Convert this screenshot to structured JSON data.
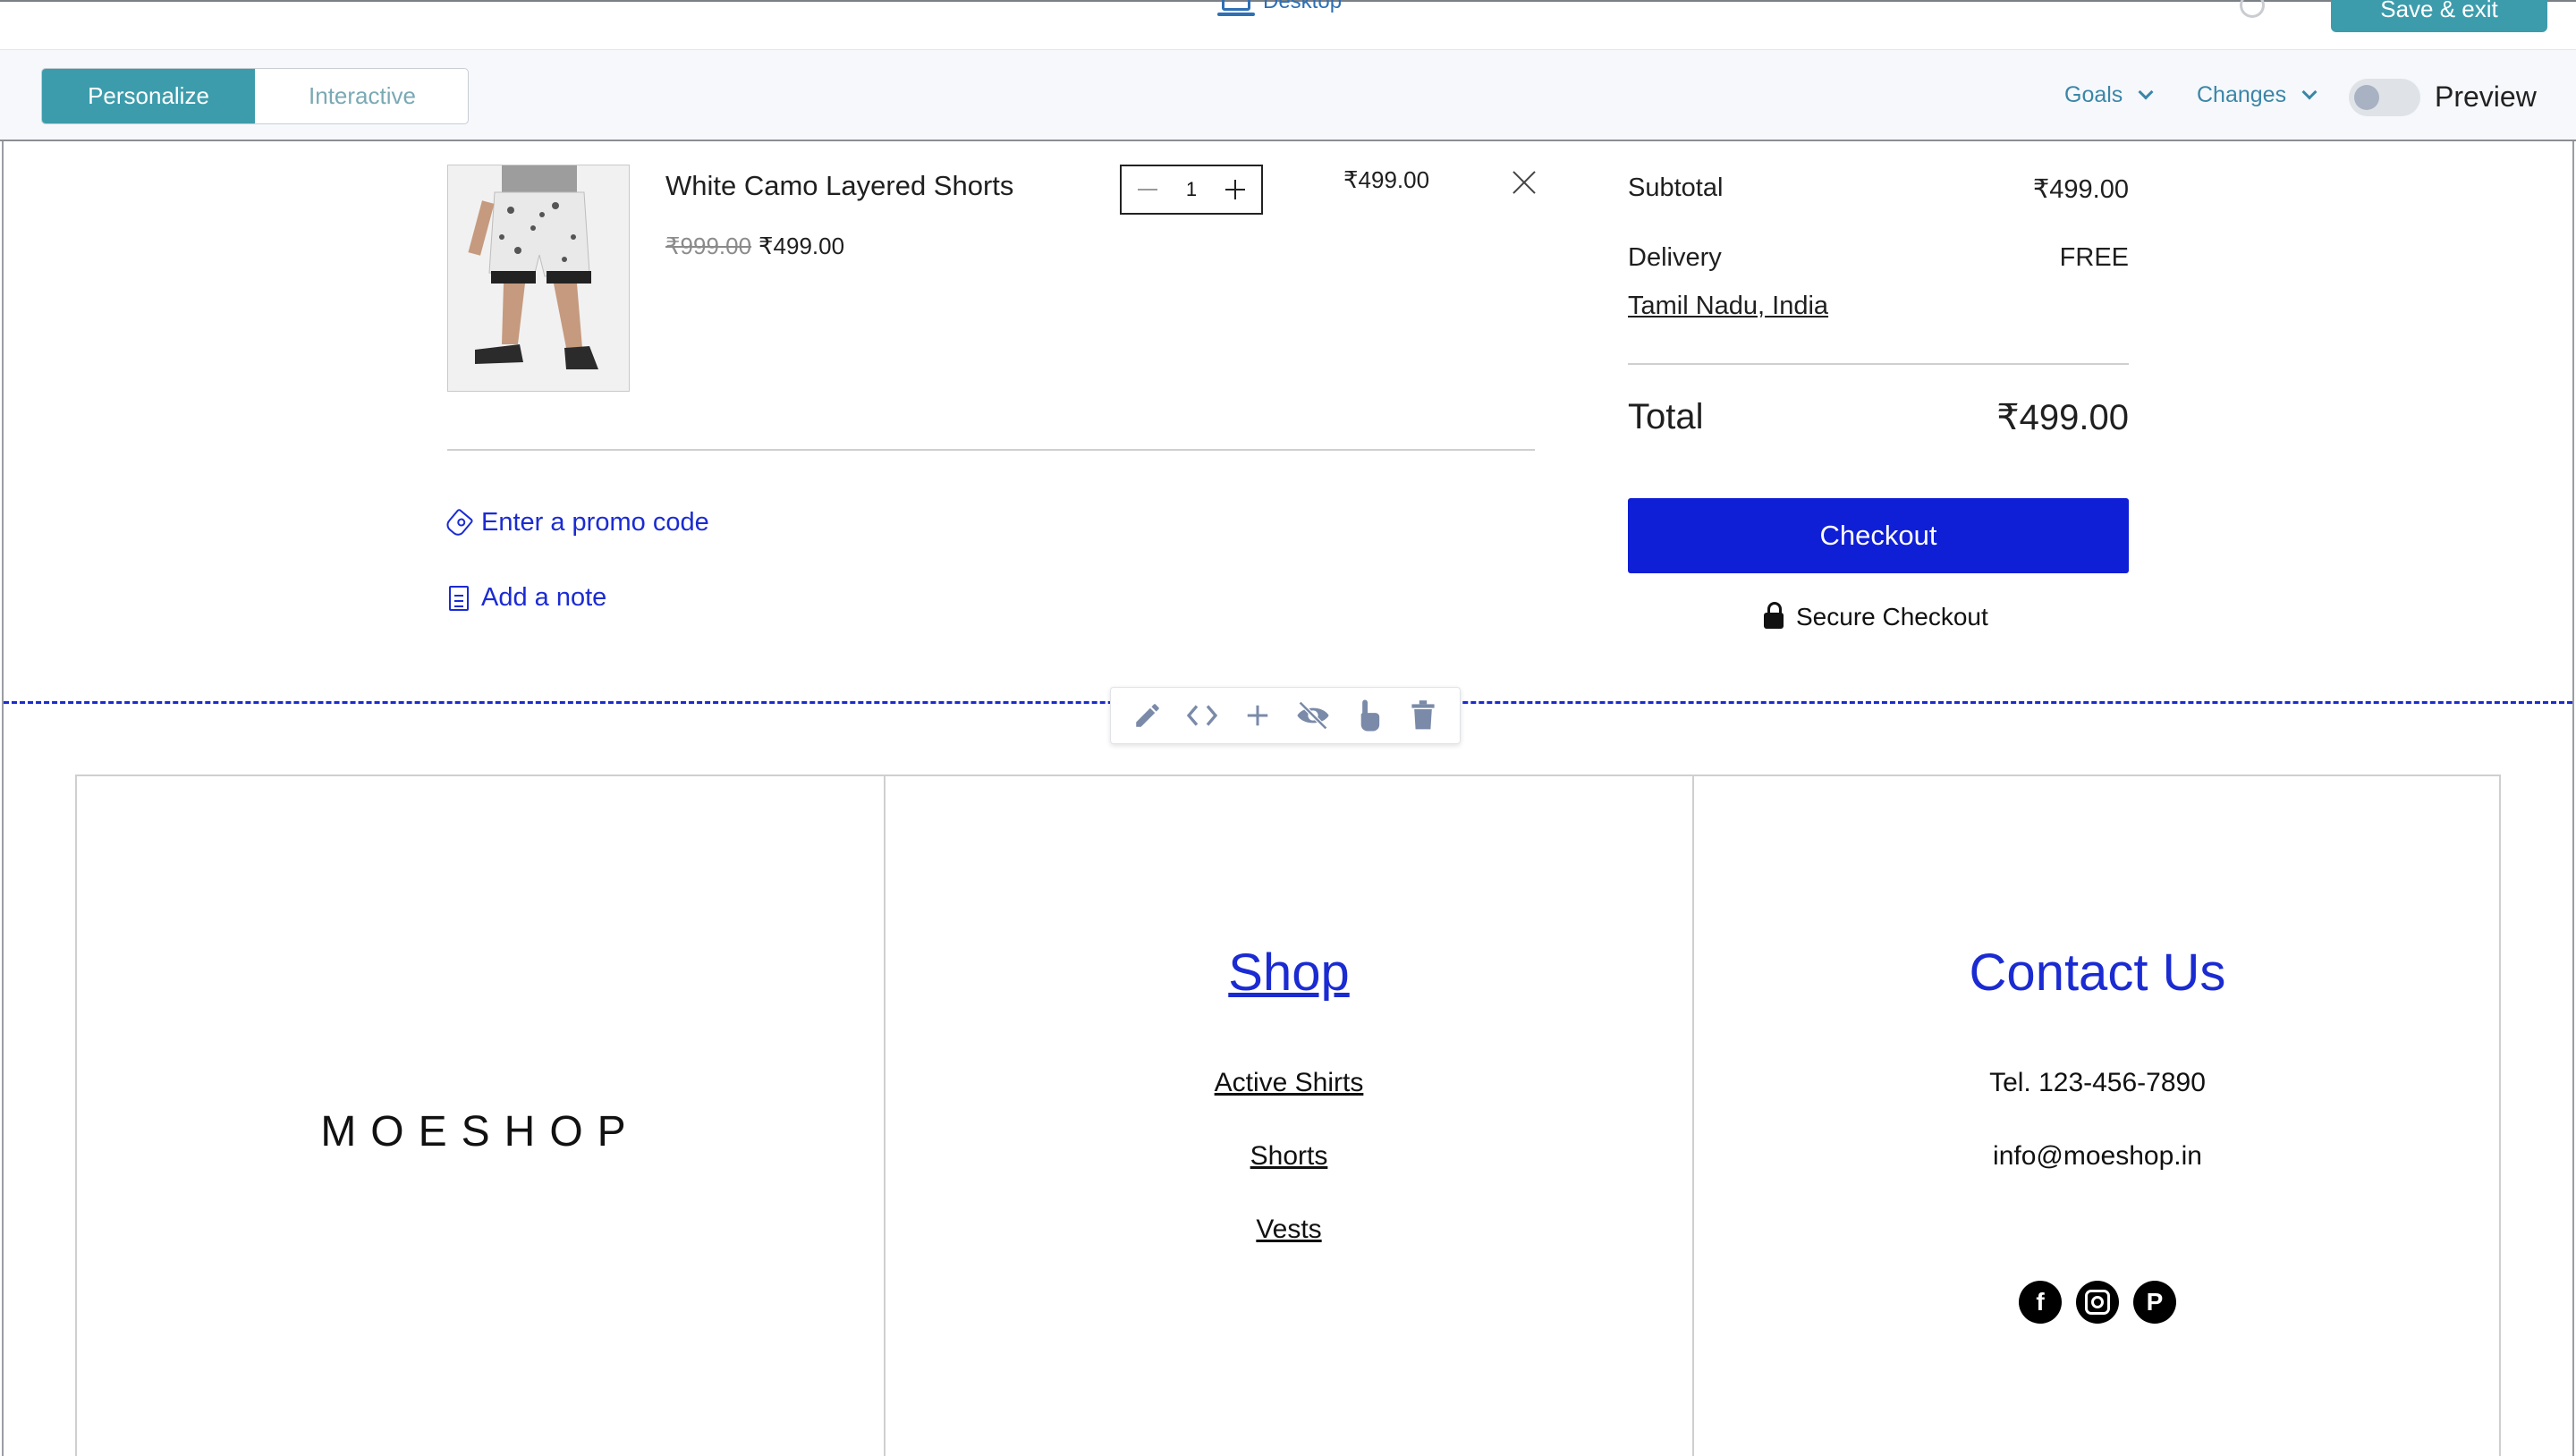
{
  "topbar": {
    "device_label": "Desktop",
    "save_exit_label": "Save & exit"
  },
  "toolbar": {
    "modes": [
      "Personalize",
      "Interactive"
    ],
    "active_mode": "Personalize",
    "goals_label": "Goals",
    "changes_label": "Changes",
    "preview_label": "Preview",
    "preview_enabled": false
  },
  "cart": {
    "item": {
      "name": "White Camo Layered Shorts",
      "original_price": "₹999.00",
      "sale_price": "₹499.00",
      "quantity": "1",
      "line_total": "₹499.00"
    },
    "promo_label": "Enter a promo code",
    "note_label": "Add a note"
  },
  "summary": {
    "subtotal_label": "Subtotal",
    "subtotal_value": "₹499.00",
    "delivery_label": "Delivery",
    "delivery_value": "FREE",
    "region": "Tamil Nadu, India",
    "total_label": "Total",
    "total_value": "₹499.00",
    "checkout_label": "Checkout",
    "secure_label": "Secure Checkout"
  },
  "element_toolbar": {
    "icons": [
      "pencil-icon",
      "code-icon",
      "plus-icon",
      "eye-off-icon",
      "pointer-icon",
      "trash-icon"
    ]
  },
  "footer": {
    "logo": "MOESHOP",
    "shop_heading": "Shop",
    "shop_links": [
      "Active Shirts",
      "Shorts",
      "Vests"
    ],
    "contact_heading": "Contact Us",
    "phone": "Tel. 123-456-7890",
    "email": "info@moeshop.in",
    "social_icons": [
      "facebook-icon",
      "instagram-icon",
      "pinterest-icon"
    ]
  },
  "colors": {
    "accent_teal": "#3d9cac",
    "link_blue": "#1b2bd2",
    "checkout_blue": "#0f1fd6"
  }
}
